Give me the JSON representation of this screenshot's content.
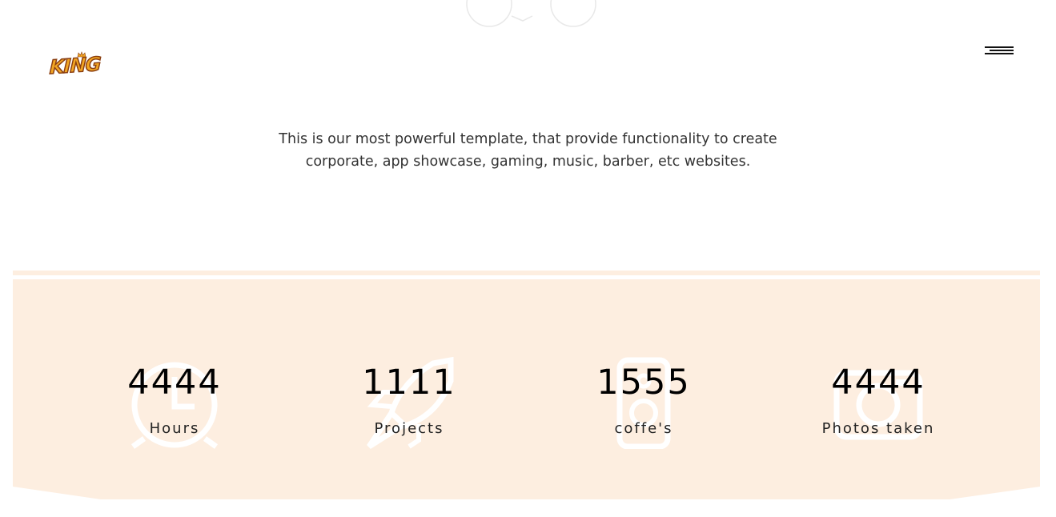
{
  "header": {
    "logo_text": "KING",
    "menu_icon": "hamburger-icon"
  },
  "intro": {
    "line1": "This is our most powerful template, that provide functionality to create",
    "line2": "corporate, app showcase, gaming, music, barber, etc websites."
  },
  "stats": {
    "background_color": "#fdeee0",
    "items": [
      {
        "number": "4444",
        "label": "Hours",
        "icon": "alarm-clock-icon"
      },
      {
        "number": "1111",
        "label": "Projects",
        "icon": "rocket-icon"
      },
      {
        "number": "1555",
        "label": "coffe's",
        "icon": "speaker-icon"
      },
      {
        "number": "4444",
        "label": "Photos taken",
        "icon": "camera-icon"
      }
    ]
  }
}
